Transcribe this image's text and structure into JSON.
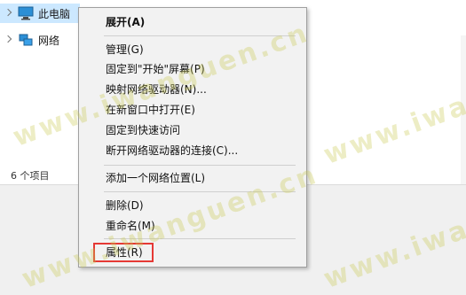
{
  "tree": {
    "items": [
      {
        "label": "此电脑",
        "icon": "computer-icon"
      },
      {
        "label": "网络",
        "icon": "network-icon"
      }
    ]
  },
  "status": {
    "item_count": "6 个项目"
  },
  "context_menu": {
    "items": [
      "展开(A)",
      "管理(G)",
      "固定到\"开始\"屏幕(P)",
      "映射网络驱动器(N)...",
      "在新窗口中打开(E)",
      "固定到快速访问",
      "断开网络驱动器的连接(C)...",
      "添加一个网络位置(L)",
      "删除(D)",
      "重命名(M)",
      "属性(R)"
    ],
    "highlight_color": "#e53935"
  },
  "watermark": {
    "text": "www.iwanguen.cn"
  }
}
